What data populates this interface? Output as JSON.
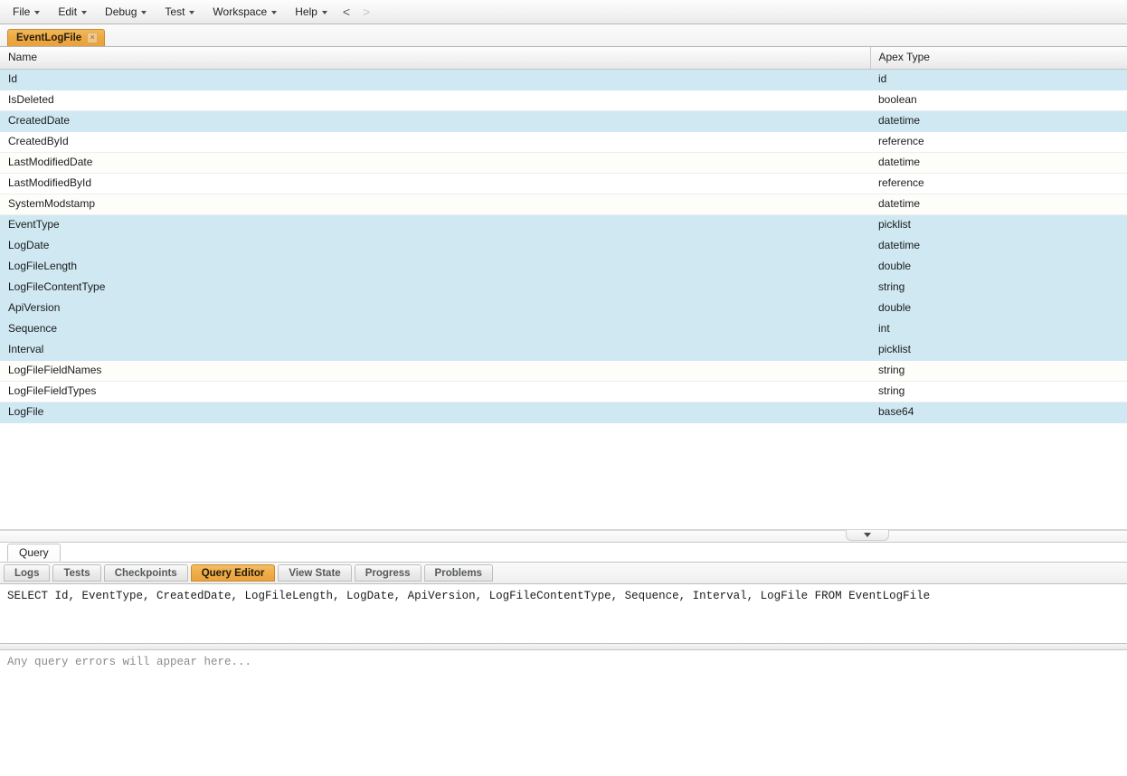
{
  "menubar": {
    "items": [
      {
        "label": "File",
        "has_caret": true
      },
      {
        "label": "Edit",
        "has_caret": true
      },
      {
        "label": "Debug",
        "has_caret": true
      },
      {
        "label": "Test",
        "has_caret": true
      },
      {
        "label": "Workspace",
        "has_caret": true
      },
      {
        "label": "Help",
        "has_caret": true
      }
    ],
    "nav_back": "<",
    "nav_forward": ">"
  },
  "document_tabs": [
    {
      "label": "EventLogFile",
      "close": "×",
      "active": true
    }
  ],
  "table": {
    "columns": [
      "Name",
      "Apex Type"
    ],
    "rows": [
      {
        "name": "Id",
        "type": "id",
        "selected": true
      },
      {
        "name": "IsDeleted",
        "type": "boolean",
        "selected": false
      },
      {
        "name": "CreatedDate",
        "type": "datetime",
        "selected": true
      },
      {
        "name": "CreatedById",
        "type": "reference",
        "selected": false
      },
      {
        "name": "LastModifiedDate",
        "type": "datetime",
        "selected": false
      },
      {
        "name": "LastModifiedById",
        "type": "reference",
        "selected": false
      },
      {
        "name": "SystemModstamp",
        "type": "datetime",
        "selected": false
      },
      {
        "name": "EventType",
        "type": "picklist",
        "selected": true
      },
      {
        "name": "LogDate",
        "type": "datetime",
        "selected": true
      },
      {
        "name": "LogFileLength",
        "type": "double",
        "selected": true
      },
      {
        "name": "LogFileContentType",
        "type": "string",
        "selected": true
      },
      {
        "name": "ApiVersion",
        "type": "double",
        "selected": true
      },
      {
        "name": "Sequence",
        "type": "int",
        "selected": true
      },
      {
        "name": "Interval",
        "type": "picklist",
        "selected": true
      },
      {
        "name": "LogFileFieldNames",
        "type": "string",
        "selected": false
      },
      {
        "name": "LogFileFieldTypes",
        "type": "string",
        "selected": false
      },
      {
        "name": "LogFile",
        "type": "base64",
        "selected": true
      }
    ]
  },
  "query_subtab": {
    "label": "Query"
  },
  "bottom_tabs": [
    {
      "label": "Logs",
      "active": false
    },
    {
      "label": "Tests",
      "active": false
    },
    {
      "label": "Checkpoints",
      "active": false
    },
    {
      "label": "Query Editor",
      "active": true
    },
    {
      "label": "View State",
      "active": false
    },
    {
      "label": "Progress",
      "active": false
    },
    {
      "label": "Problems",
      "active": false
    }
  ],
  "query_editor": {
    "value": "SELECT Id, EventType, CreatedDate, LogFileLength, LogDate, ApiVersion, LogFileContentType, Sequence, Interval, LogFile FROM EventLogFile"
  },
  "error_pane": {
    "placeholder": "Any query errors will appear here..."
  },
  "icons": {
    "caret_down": "caret-down-icon",
    "collapse_handle": "collapse-down-icon",
    "tab_close": "close-icon"
  },
  "colors": {
    "accent": "#eaa23c",
    "selected_row": "#cfe8f2",
    "chrome": "#f1f1f1"
  }
}
